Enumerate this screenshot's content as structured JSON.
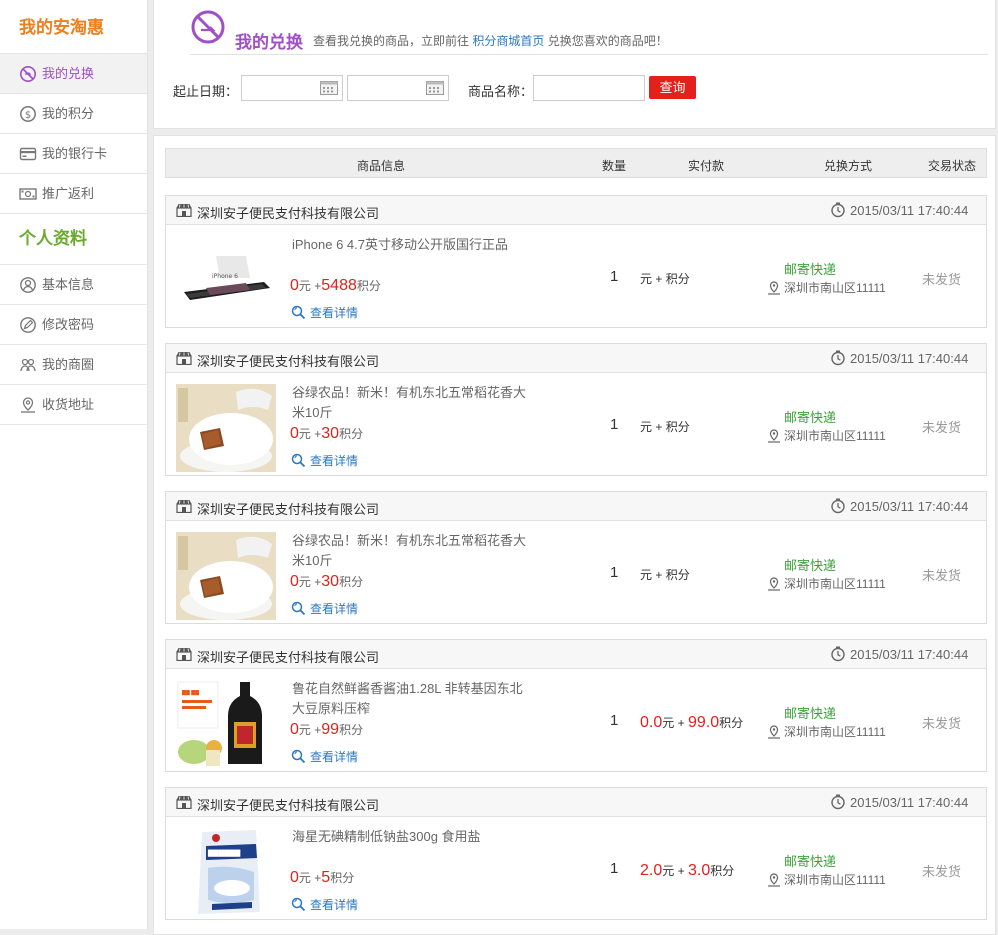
{
  "sidebar": {
    "heading1": "我的安淘惠",
    "items1": [
      {
        "label": "我的兑换",
        "icon": "no-symbol-icon",
        "active": true
      },
      {
        "label": "我的积分",
        "icon": "dollar-coin-icon"
      },
      {
        "label": "我的银行卡",
        "icon": "credit-card-icon"
      },
      {
        "label": "推广返利",
        "icon": "cash-icon"
      }
    ],
    "heading2": "个人资料",
    "items2": [
      {
        "label": "基本信息",
        "icon": "user-icon"
      },
      {
        "label": "修改密码",
        "icon": "pencil-icon"
      },
      {
        "label": "我的商圈",
        "icon": "group-icon"
      },
      {
        "label": "收货地址",
        "icon": "location-pin-icon"
      }
    ]
  },
  "header": {
    "title": "我的兑换",
    "desc_prefix": "查看我兑换的商品，立即前往",
    "desc_link": "积分商城首页",
    "desc_suffix": "兑换您喜欢的商品吧！"
  },
  "filters": {
    "date_label": "起止日期：",
    "start_date": "",
    "end_date": "",
    "name_label": "商品名称：",
    "name_value": "",
    "query_label": "查询"
  },
  "table_headers": [
    "商品信息",
    "数量",
    "实付款",
    "兑换方式",
    "交易状态"
  ],
  "orders": [
    {
      "shop": "深圳安子便民支付科技有限公司",
      "time": "2015/03/11 17:40:44",
      "title": "iPhone 6 4.7英寸移动公开版国行正品",
      "price_cash": "0",
      "price_unit": "元",
      "price_plus": "+",
      "price_points": "5488",
      "points_unit": "积分",
      "detail": "查看详情",
      "qty": "1",
      "pay_cash": "",
      "pay_unit": "元",
      "pay_plus": "+",
      "pay_points": "",
      "pay_points_unit": "积分",
      "ship": "邮寄快递",
      "addr": "深圳市南山区11111",
      "status": "未发货",
      "image": "phone"
    },
    {
      "shop": "深圳安子便民支付科技有限公司",
      "time": "2015/03/11 17:40:44",
      "title": "谷绿农品！新米！有机东北五常稻花香大米10斤",
      "price_cash": "0",
      "price_unit": "元",
      "price_plus": "+",
      "price_points": "30",
      "points_unit": "积分",
      "detail": "查看详情",
      "qty": "1",
      "pay_cash": "",
      "pay_unit": "元",
      "pay_plus": "+",
      "pay_points": "",
      "pay_points_unit": "积分",
      "ship": "邮寄快递",
      "addr": "深圳市南山区11111",
      "status": "未发货",
      "image": "rice"
    },
    {
      "shop": "深圳安子便民支付科技有限公司",
      "time": "2015/03/11 17:40:44",
      "title": "谷绿农品！新米！有机东北五常稻花香大米10斤",
      "price_cash": "0",
      "price_unit": "元",
      "price_plus": "+",
      "price_points": "30",
      "points_unit": "积分",
      "detail": "查看详情",
      "qty": "1",
      "pay_cash": "",
      "pay_unit": "元",
      "pay_plus": "+",
      "pay_points": "",
      "pay_points_unit": "积分",
      "ship": "邮寄快递",
      "addr": "深圳市南山区11111",
      "status": "未发货",
      "image": "rice"
    },
    {
      "shop": "深圳安子便民支付科技有限公司",
      "time": "2015/03/11 17:40:44",
      "title": "鲁花自然鲜酱香酱油1.28L 非转基因东北大豆原料压榨",
      "price_cash": "0",
      "price_unit": "元",
      "price_plus": "+",
      "price_points": "99",
      "points_unit": "积分",
      "detail": "查看详情",
      "qty": "1",
      "pay_cash": "0.0",
      "pay_unit": "元",
      "pay_plus": "+",
      "pay_points": "99.0",
      "pay_points_unit": "积分",
      "ship": "邮寄快递",
      "addr": "深圳市南山区11111",
      "status": "未发货",
      "image": "soy"
    },
    {
      "shop": "深圳安子便民支付科技有限公司",
      "time": "2015/03/11 17:40:44",
      "title": "海星无碘精制低钠盐300g 食用盐",
      "price_cash": "0",
      "price_unit": "元",
      "price_plus": "+",
      "price_points": "5",
      "points_unit": "积分",
      "detail": "查看详情",
      "qty": "1",
      "pay_cash": "2.0",
      "pay_unit": "元",
      "pay_plus": "+",
      "pay_points": "3.0",
      "pay_points_unit": "积分",
      "ship": "邮寄快递",
      "addr": "深圳市南山区11111",
      "status": "未发货",
      "image": "salt"
    }
  ],
  "colors": {
    "accent_purple": "#a04fc7",
    "brand_orange": "#ef7e1c",
    "section_green": "#6aaa2d",
    "price_red": "#e3201b",
    "link_blue": "#2a78c2",
    "ship_green": "#3aa13a"
  }
}
